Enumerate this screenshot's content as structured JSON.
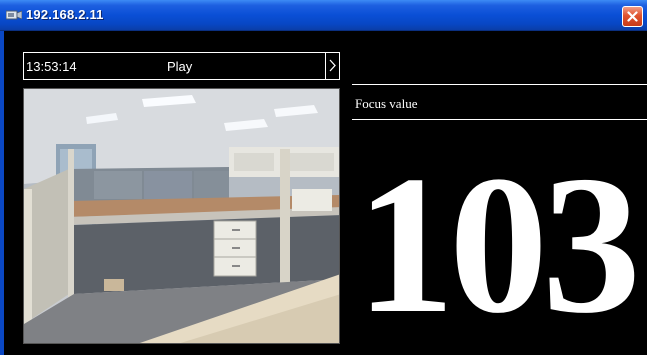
{
  "window": {
    "title": "192.168.2.11",
    "icon": "camera-app-icon",
    "close_icon": "close-icon"
  },
  "player": {
    "time": "13:53:14",
    "play_label": "Play",
    "next_icon": "chevron-right-icon"
  },
  "focus": {
    "label": "Focus value",
    "value": "103"
  },
  "colors": {
    "titlebar": "#0a4fd6",
    "close": "#e0532f",
    "background": "#000000",
    "text": "#ffffff"
  }
}
